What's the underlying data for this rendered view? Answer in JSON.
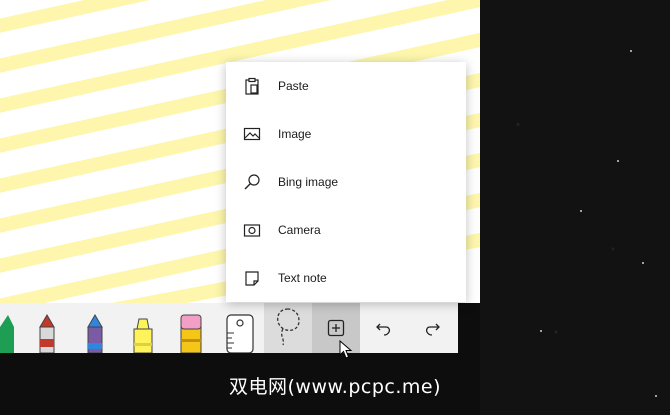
{
  "insert_menu": {
    "items": [
      {
        "label": "Paste",
        "icon": "paste-icon"
      },
      {
        "label": "Image",
        "icon": "image-icon"
      },
      {
        "label": "Bing image",
        "icon": "search-icon"
      },
      {
        "label": "Camera",
        "icon": "camera-icon"
      },
      {
        "label": "Text note",
        "icon": "note-icon"
      }
    ]
  },
  "toolbar": {
    "tools": [
      "green-marker",
      "red-marker",
      "blue-marker",
      "pencil",
      "highlighter",
      "eraser",
      "ruler",
      "lasso-select",
      "add-insert",
      "undo",
      "redo"
    ]
  },
  "watermark": "双电网(www.pcpc.me)",
  "colors": {
    "highlight": "#fdf6a8",
    "menu_bg": "#ffffff",
    "toolbar_bg": "#f2f2f2",
    "active_button": "#c8c8c8"
  }
}
